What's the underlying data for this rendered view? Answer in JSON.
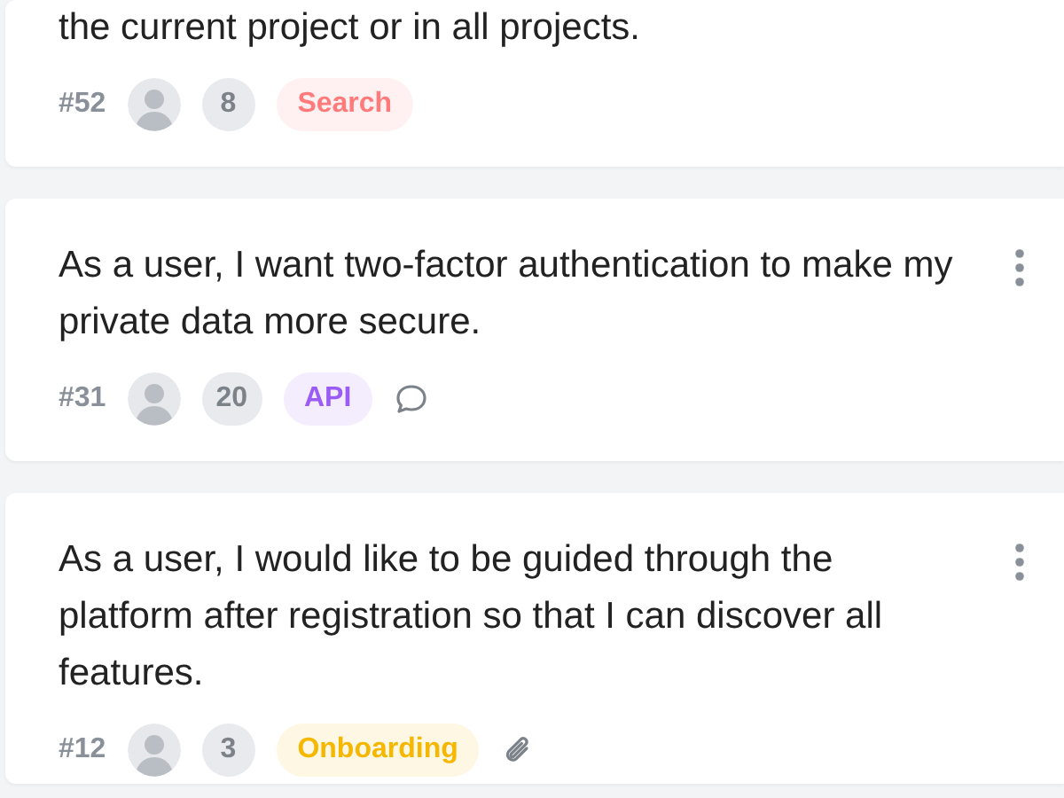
{
  "cards": [
    {
      "text": "the current project or in all projects.",
      "menu": false,
      "id": "#52",
      "count": "8",
      "tag": {
        "label": "Search",
        "color": "#ff7b7b"
      }
    },
    {
      "text": "As a user, I want two-factor authentication to make my private data more secure.",
      "menu": true,
      "id": "#31",
      "count": "20",
      "tag": {
        "label": "API",
        "color": "#9a5cf5"
      },
      "extras": [
        {
          "kind": "comment"
        }
      ]
    },
    {
      "text": "As a user, I would like to be guided through the platform after registration so that I can discover all features.",
      "menu": true,
      "id": "#12",
      "count": "3",
      "tag": {
        "label": "Onboarding",
        "color": "#f5b700"
      },
      "extras": [
        {
          "kind": "attachment"
        }
      ]
    }
  ]
}
